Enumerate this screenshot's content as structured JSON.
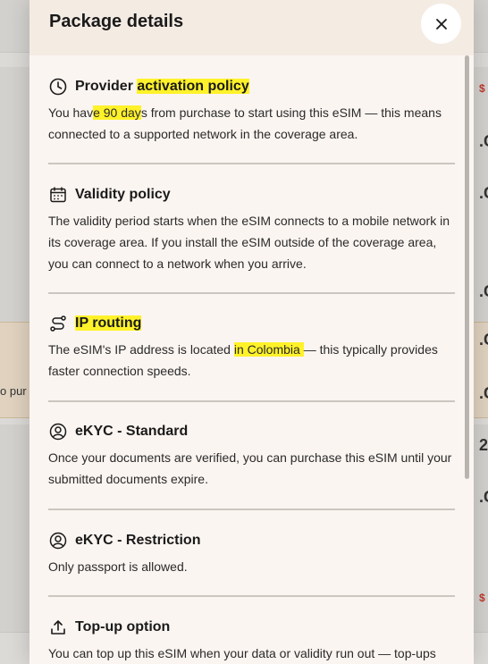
{
  "modal": {
    "title": "Package details",
    "close_glyph": "×"
  },
  "background": {
    "cta_fragment": "o pur",
    "edge_fragments": [
      "$",
      ".C",
      ".C",
      ".C",
      ".C",
      ".C",
      "2",
      ".C",
      "$"
    ]
  },
  "sections": [
    {
      "icon": "clock-icon",
      "title_pre": "Provider ",
      "title_mark": "activation policy",
      "body_pre": "You hav",
      "body_mark": "e 90 day",
      "body_post": "s from purchase to start using this eSIM — this means connected to a supported network in the coverage area."
    },
    {
      "icon": "calendar-icon",
      "title": "Validity policy",
      "body": "The validity period starts when the eSIM connects to a mobile network in its coverage area. If you install the eSIM outside of the coverage area, you can connect to a network when you arrive."
    },
    {
      "icon": "route-icon",
      "title_mark": "IP routing",
      "body_pre": "The eSIM's IP address is located ",
      "body_mark": "in Colombia ",
      "body_post": "— this typically provides faster connection speeds."
    },
    {
      "icon": "user-circle-icon",
      "title": "eKYC - Standard",
      "body": "Once your documents are verified, you can purchase this eSIM until your submitted documents expire."
    },
    {
      "icon": "user-circle-icon",
      "title": "eKYC - Restriction",
      "body": "Only passport is allowed."
    },
    {
      "icon": "upload-icon",
      "title": "Top-up option",
      "body": "You can top up this eSIM when your data or validity run out — top-ups"
    }
  ],
  "colors": {
    "highlight": "#fff22a",
    "modal_bg": "#fbf5f1",
    "header_bg": "#f4ebe3"
  }
}
